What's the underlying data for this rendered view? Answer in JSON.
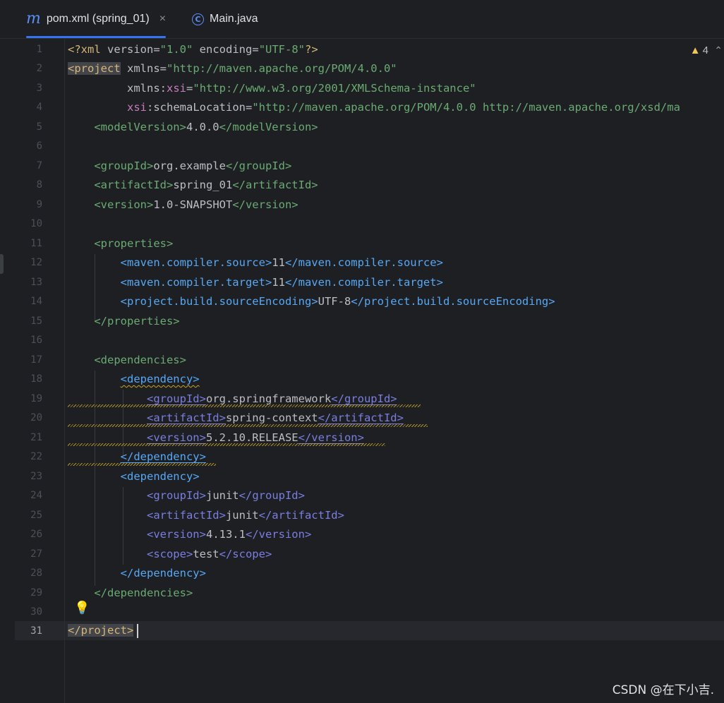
{
  "tabs": [
    {
      "label": "pom.xml (spring_01)",
      "icon": "maven-icon",
      "active": true,
      "close": "×"
    },
    {
      "label": "Main.java",
      "icon": "java-class-icon",
      "active": false
    }
  ],
  "inspection": {
    "warnings": "4",
    "icon": "warning-icon"
  },
  "line_numbers": [
    "1",
    "2",
    "3",
    "4",
    "5",
    "6",
    "7",
    "8",
    "9",
    "10",
    "11",
    "12",
    "13",
    "14",
    "15",
    "16",
    "17",
    "18",
    "19",
    "20",
    "21",
    "22",
    "23",
    "24",
    "25",
    "26",
    "27",
    "28",
    "29",
    "30",
    "31"
  ],
  "current_line": "31",
  "code": {
    "l1": {
      "a": "<?xml ",
      "b": "version",
      "c": "=",
      "d": "\"1.0\"",
      "e": " encoding",
      "f": "=",
      "g": "\"UTF-8\"",
      "h": "?>"
    },
    "l2": {
      "a": "<project",
      "b": " xmlns",
      "c": "=",
      "d": "\"http://maven.apache.org/POM/4.0.0\""
    },
    "l3": {
      "pad": "         ",
      "a": "xmlns",
      "b": ":",
      "c": "xsi",
      "d": "=",
      "e": "\"http://www.w3.org/2001/XMLSchema-instance\""
    },
    "l4": {
      "pad": "         ",
      "a": "xsi",
      "b": ":schemaLocation",
      "c": "=",
      "d": "\"http://maven.apache.org/POM/4.0.0 http://maven.apache.org/xsd/ma"
    },
    "l5": {
      "pad": "    ",
      "a": "<modelVersion>",
      "b": "4.0.0",
      "c": "</modelVersion>"
    },
    "l7": {
      "pad": "    ",
      "a": "<groupId>",
      "b": "org.example",
      "c": "</groupId>"
    },
    "l8": {
      "pad": "    ",
      "a": "<artifactId>",
      "b": "spring_01",
      "c": "</artifactId>"
    },
    "l9": {
      "pad": "    ",
      "a": "<version>",
      "b": "1.0-SNAPSHOT",
      "c": "</version>"
    },
    "l11": {
      "pad": "    ",
      "a": "<properties>"
    },
    "l12": {
      "pad": "        ",
      "a": "<maven.compiler.source>",
      "b": "11",
      "c": "</maven.compiler.source>"
    },
    "l13": {
      "pad": "        ",
      "a": "<maven.compiler.target>",
      "b": "11",
      "c": "</maven.compiler.target>"
    },
    "l14": {
      "pad": "        ",
      "a": "<project.build.sourceEncoding>",
      "b": "UTF-8",
      "c": "</project.build.sourceEncoding>"
    },
    "l15": {
      "pad": "    ",
      "a": "</properties>"
    },
    "l17": {
      "pad": "    ",
      "a": "<dependencies>"
    },
    "l18": {
      "pad": "        ",
      "a": "<dependency>"
    },
    "l19": {
      "pad": "            ",
      "a": "<groupId>",
      "b": "org.springframework",
      "c": "</groupId>"
    },
    "l20": {
      "pad": "            ",
      "a": "<artifactId>",
      "b": "spring-context",
      "c": "</artifactId>"
    },
    "l21": {
      "pad": "            ",
      "a": "<version>",
      "b": "5.2.10.RELEASE",
      "c": "</version>"
    },
    "l22": {
      "pad": "        ",
      "a": "</dependency>"
    },
    "l23": {
      "pad": "        ",
      "a": "<dependency>"
    },
    "l24": {
      "pad": "            ",
      "a": "<groupId>",
      "b": "junit",
      "c": "</groupId>"
    },
    "l25": {
      "pad": "            ",
      "a": "<artifactId>",
      "b": "junit",
      "c": "</artifactId>"
    },
    "l26": {
      "pad": "            ",
      "a": "<version>",
      "b": "4.13.1",
      "c": "</version>"
    },
    "l27": {
      "pad": "            ",
      "a": "<scope>",
      "b": "test",
      "c": "</scope>"
    },
    "l28": {
      "pad": "        ",
      "a": "</dependency>"
    },
    "l29": {
      "pad": "    ",
      "a": "</dependencies>"
    },
    "l31": {
      "a": "</project>"
    }
  },
  "watermark": "CSDN @在下小吉.",
  "colors": {
    "background": "#1e1f22",
    "tag_green": "#6aab73",
    "tag_blue": "#56a8f5",
    "tag_purple": "#7a7ee0",
    "accent": "#3574f0",
    "warning": "#f2c55c"
  }
}
